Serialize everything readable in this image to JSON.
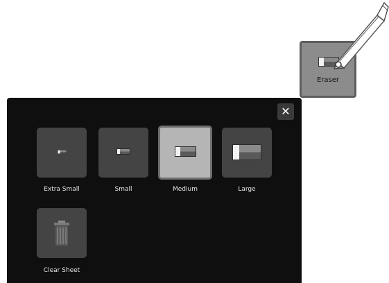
{
  "tool": {
    "label": "Eraser",
    "icon": "eraser-icon"
  },
  "pen": {
    "icon": "pen-icon"
  },
  "panel": {
    "close_glyph": "✕",
    "sizes": [
      {
        "label": "Extra Small",
        "icon": "eraser-extra-small-icon",
        "selected": false
      },
      {
        "label": "Small",
        "icon": "eraser-small-icon",
        "selected": false
      },
      {
        "label": "Medium",
        "icon": "eraser-medium-icon",
        "selected": true
      },
      {
        "label": "Large",
        "icon": "eraser-large-icon",
        "selected": false
      }
    ],
    "clear": {
      "label": "Clear Sheet",
      "icon": "trash-icon"
    }
  },
  "colors": {
    "panel_bg": "#0f0f0f",
    "tile_bg": "#444444",
    "tile_selected_bg": "#b5b5b5",
    "tool_bg": "#8c8c8c"
  }
}
